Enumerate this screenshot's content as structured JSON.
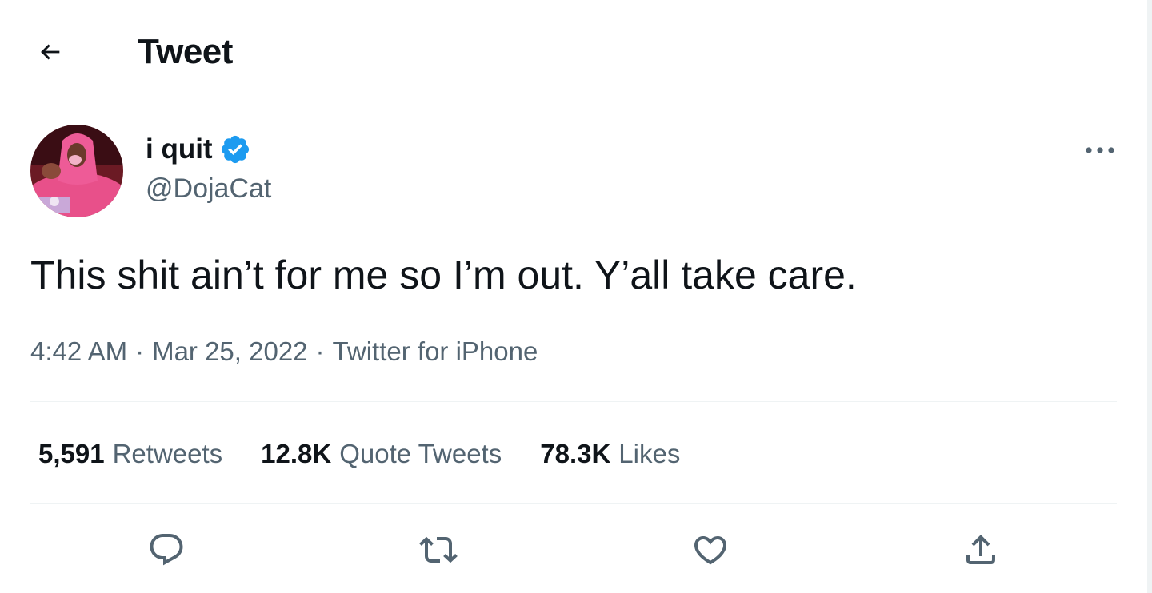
{
  "header": {
    "back_icon": "arrow-left-icon",
    "title": "Tweet"
  },
  "author": {
    "display_name": "i quit",
    "verified_icon": "verified-badge-icon",
    "handle": "@DojaCat",
    "avatar_icon": "avatar-photo"
  },
  "tweet": {
    "text": "This shit ain’t for me so I’m out. Y’all take care.",
    "time": "4:42 AM",
    "date": "Mar 25, 2022",
    "separator": "·",
    "source": "Twitter for iPhone"
  },
  "stats": [
    {
      "count": "5,591",
      "label": "Retweets"
    },
    {
      "count": "12.8K",
      "label": "Quote Tweets"
    },
    {
      "count": "78.3K",
      "label": "Likes"
    }
  ],
  "actions": [
    "reply-icon",
    "retweet-icon",
    "like-icon",
    "share-icon"
  ],
  "colors": {
    "text": "#0f1419",
    "secondary": "#536471",
    "verified": "#1d9bf0",
    "divider": "#eff3f4"
  }
}
